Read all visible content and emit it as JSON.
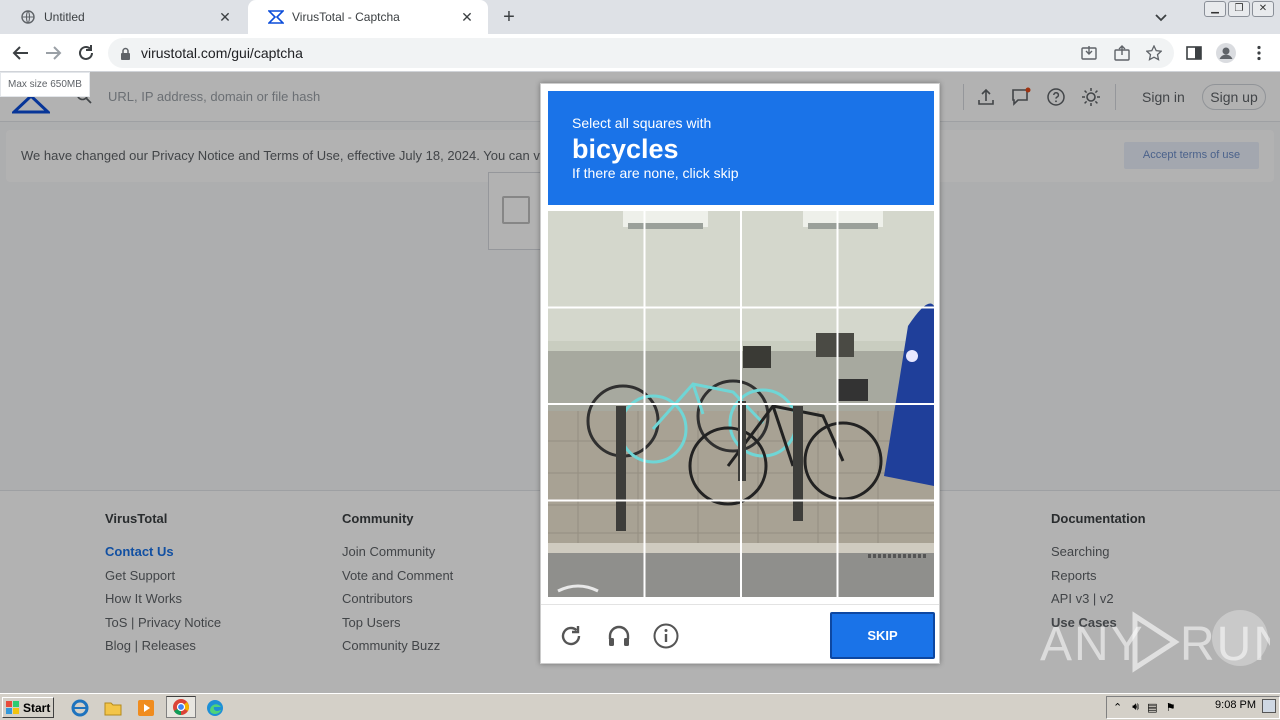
{
  "browser": {
    "tabs": [
      {
        "title": "Untitled",
        "icon": "globe-icon",
        "active": false
      },
      {
        "title": "VirusTotal - Captcha",
        "icon": "virustotal-icon",
        "active": true
      }
    ],
    "url": "virustotal.com/gui/captcha"
  },
  "site": {
    "max_size_badge": "Max size 650MB",
    "search_placeholder": "URL, IP address, domain or file hash",
    "sign_in": "Sign in",
    "sign_up": "Sign up",
    "notice_text": "We have changed our Privacy Notice and Terms of Use, effective July 18, 2024. You can v",
    "notice_button": "Accept terms of use"
  },
  "captcha": {
    "instruction": "Select all squares with",
    "target": "bicycles",
    "hint": "If there are none, click skip",
    "skip_label": "SKIP",
    "grid_size": 4
  },
  "footer": {
    "columns": [
      {
        "heading": "VirusTotal",
        "links": [
          "Contact Us",
          "Get Support",
          "How It Works",
          "ToS | Privacy Notice",
          "Blog | Releases"
        ]
      },
      {
        "heading": "Community",
        "links": [
          "Join Community",
          "Vote and Comment",
          "Contributors",
          "Top Users",
          "Community Buzz"
        ]
      },
      {
        "heading": "Documentation",
        "links": [
          "Searching",
          "Reports",
          "API v3 | v2",
          "Use Cases"
        ]
      }
    ]
  },
  "watermark": "ANY RUN",
  "taskbar": {
    "start": "Start",
    "clock": "9:08 PM"
  },
  "colors": {
    "accent": "#1a73e8",
    "tab_bg": "#dee1e6"
  }
}
